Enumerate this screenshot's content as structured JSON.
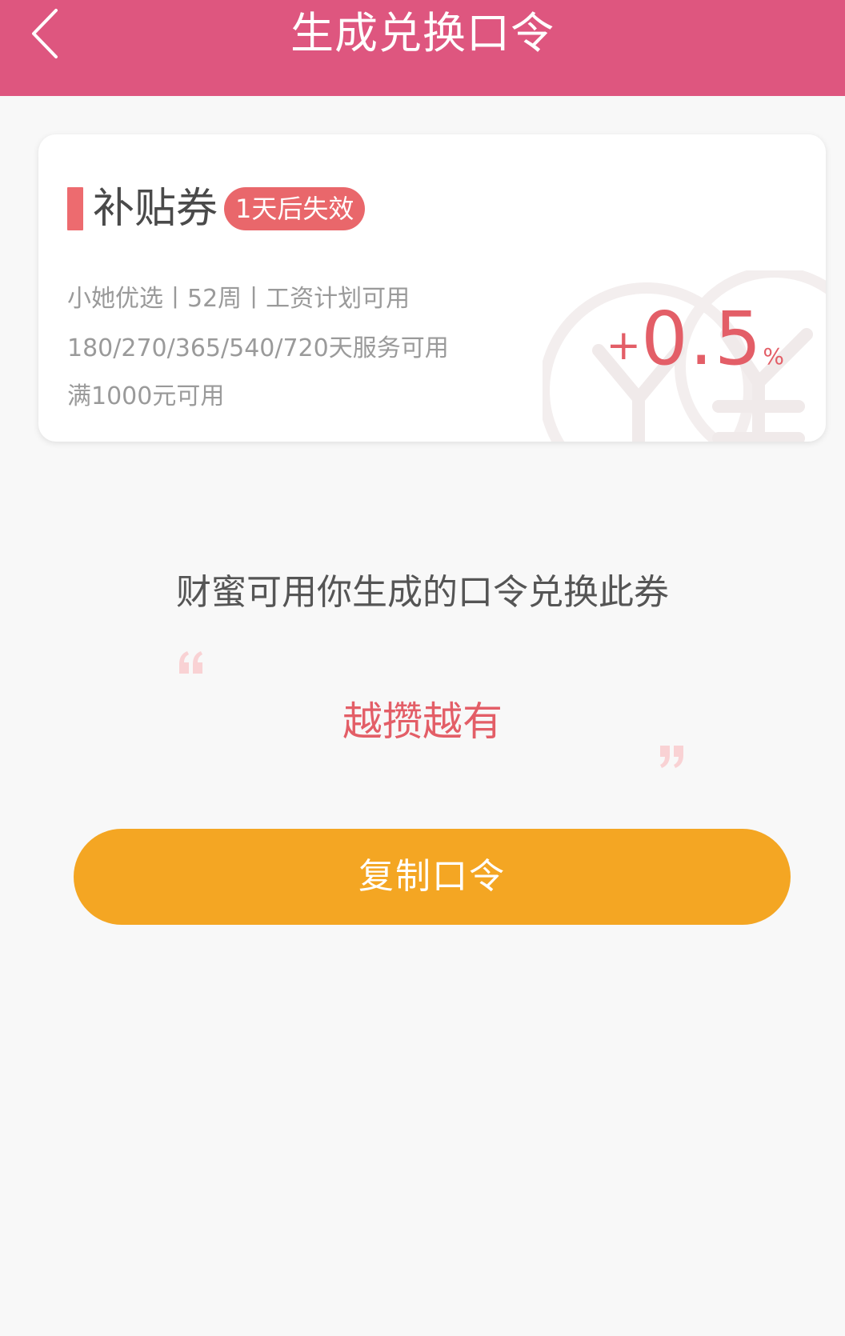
{
  "header": {
    "title": "生成兑换口令",
    "back_icon": "chevron-left-icon"
  },
  "coupon": {
    "title": "补贴券",
    "expire_badge": "1天后失效",
    "conditions": [
      "小她优选丨52周丨工资计划可用",
      "180/270/365/540/720天服务可用",
      "满1000元可用"
    ],
    "rate_sign": "+",
    "rate_value": "0.5",
    "rate_unit": "%",
    "watermark_icon": "yuan-icon"
  },
  "description": "财蜜可用你生成的口令兑换此券",
  "command": {
    "text": "越攒越有",
    "open_quote_icon": "open-quote-icon",
    "close_quote_icon": "close-quote-icon"
  },
  "copy_button": {
    "label": "复制口令"
  },
  "colors": {
    "header_bg": "#de567f",
    "accent_red": "#e35e67",
    "button_orange": "#f4a623",
    "badge_red": "#e9676b",
    "background": "#f8f8f8"
  }
}
